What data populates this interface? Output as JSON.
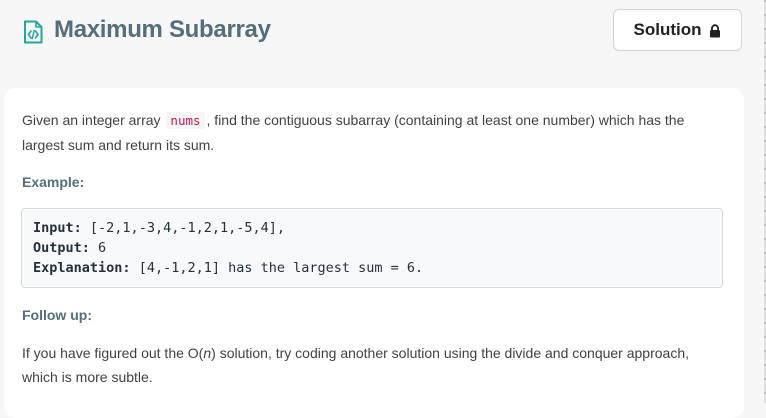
{
  "header": {
    "title": "Maximum Subarray",
    "title_icon": "code-file-icon",
    "solution_button": {
      "label": "Solution",
      "icon": "lock-icon"
    }
  },
  "problem": {
    "description_before": "Given an integer array",
    "description_code": "nums",
    "description_after": ", find the contiguous subarray (containing at least one number) which has the largest sum and return its sum.",
    "example_heading": "Example:",
    "example": {
      "input_label": "Input:",
      "input_value": "[-2,1,-3,4,-1,2,1,-5,4],",
      "output_label": "Output:",
      "output_value": "6",
      "explanation_label": "Explanation:",
      "explanation_value": "[4,-1,2,1] has the largest sum = 6."
    },
    "follow_up_heading": "Follow up:",
    "follow_up_before": "If you have figured out the O(",
    "follow_up_n": "n",
    "follow_up_after": ") solution, try coding another solution using the divide and conquer approach, which is more subtle."
  },
  "colors": {
    "page_background": "#f7f7f7",
    "title_color": "#546e7a",
    "icon_color": "#26a69a",
    "inline_code_color": "#c2185b"
  }
}
